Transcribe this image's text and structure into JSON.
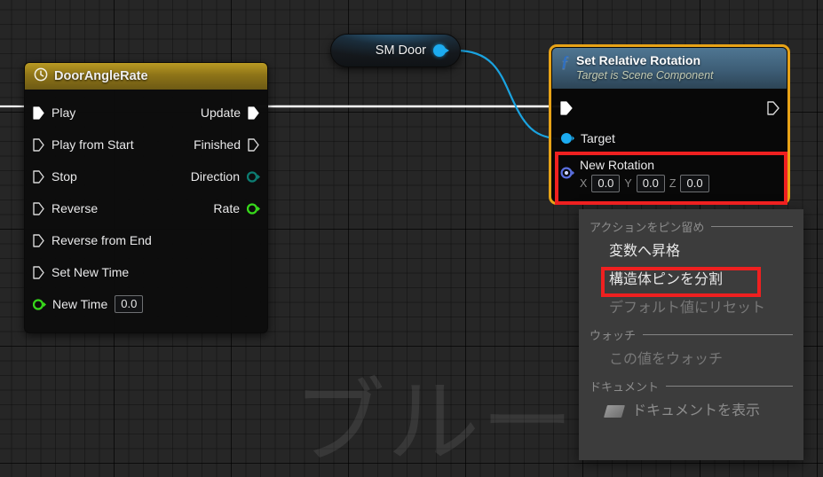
{
  "app": {
    "watermark_text": "ブルー",
    "canvas_bg": "#262626",
    "grid_line_color": "#000000"
  },
  "timeline_node": {
    "title": "DoorAngleRate",
    "icon": "clock-icon",
    "header_color": "#8e7418",
    "input_pins": [
      {
        "label": "Play",
        "type": "exec",
        "connected": true
      },
      {
        "label": "Play from Start",
        "type": "exec",
        "connected": false
      },
      {
        "label": "Stop",
        "type": "exec",
        "connected": false
      },
      {
        "label": "Reverse",
        "type": "exec",
        "connected": false
      },
      {
        "label": "Reverse from End",
        "type": "exec",
        "connected": false
      },
      {
        "label": "Set New Time",
        "type": "exec",
        "connected": false
      }
    ],
    "output_pins": [
      {
        "label": "Update",
        "type": "exec",
        "connected": true
      },
      {
        "label": "Finished",
        "type": "exec",
        "connected": false
      },
      {
        "label": "Direction",
        "type": "byte",
        "color": "#0d6b63",
        "connected": false
      },
      {
        "label": "Rate",
        "type": "float",
        "color": "#37d81b",
        "connected": false
      }
    ],
    "new_time": {
      "label": "New Time",
      "value": "0.0",
      "type": "float",
      "color": "#37d81b"
    }
  },
  "smdoor_node": {
    "title": "SM Door",
    "output_pin_color": "#1cabf0",
    "connected": true
  },
  "set_relative_rotation_node": {
    "title": "Set Relative Rotation",
    "subtitle": "Target is Scene Component",
    "icon": "function-icon",
    "selected": true,
    "selection_color": "#e8a317",
    "header_color": "#3d5d76",
    "target_pin": {
      "label": "Target",
      "type": "object",
      "color": "#1cabf0"
    },
    "new_rotation": {
      "label": "New Rotation",
      "type": "rotator",
      "color": "#4f66d8",
      "axes": [
        {
          "label": "X",
          "value": "0.0"
        },
        {
          "label": "Y",
          "value": "0.0"
        },
        {
          "label": "Z",
          "value": "0.0"
        }
      ]
    }
  },
  "context_menu": {
    "sections": [
      {
        "header": "アクションをピン留め",
        "items": [
          {
            "label": "変数へ昇格",
            "disabled": false,
            "highlighted": false
          },
          {
            "label": "構造体ピンを分割",
            "disabled": false,
            "highlighted": true
          },
          {
            "label": "デフォルト値にリセット",
            "disabled": true,
            "highlighted": false
          }
        ]
      },
      {
        "header": "ウォッチ",
        "items": [
          {
            "label": "この値をウォッチ",
            "disabled": true,
            "highlighted": false
          }
        ]
      },
      {
        "header": "ドキュメント",
        "items": [
          {
            "label": "ドキュメントを表示",
            "disabled": true,
            "highlighted": false,
            "icon": "document-icon"
          }
        ]
      }
    ]
  },
  "annotations": {
    "highlight_color": "#ef2020",
    "boxes": [
      {
        "name": "new-rotation-pin-highlight"
      },
      {
        "name": "split-struct-pin-highlight"
      }
    ]
  }
}
